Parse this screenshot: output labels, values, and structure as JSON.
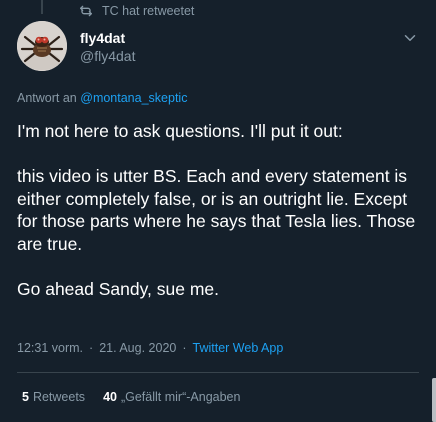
{
  "retweet_banner": {
    "icon": "retweet-icon",
    "text": "TC hat retweetet"
  },
  "author": {
    "display_name": "fly4dat",
    "handle": "@fly4dat",
    "avatar": "avatar-image"
  },
  "reply": {
    "prefix": "Antwort an",
    "mention": "@montana_skeptic"
  },
  "tweet": {
    "paragraphs": [
      "I'm not here to ask questions. I'll put it out:",
      "this video is utter BS. Each and every statement is either completely false, or is an outright lie. Except for those parts where he says that Tesla lies. Those are true.",
      "Go ahead Sandy, sue me."
    ]
  },
  "meta": {
    "time": "12:31 vorm.",
    "date": "21. Aug. 2020",
    "separator": "·",
    "app": "Twitter Web App"
  },
  "stats": {
    "retweets_count": "5",
    "retweets_label": "Retweets",
    "likes_count": "40",
    "likes_label": "„Gefällt mir“-Angaben"
  },
  "colors": {
    "background": "#15202b",
    "accent": "#1da1f2",
    "muted": "#8899a6"
  }
}
